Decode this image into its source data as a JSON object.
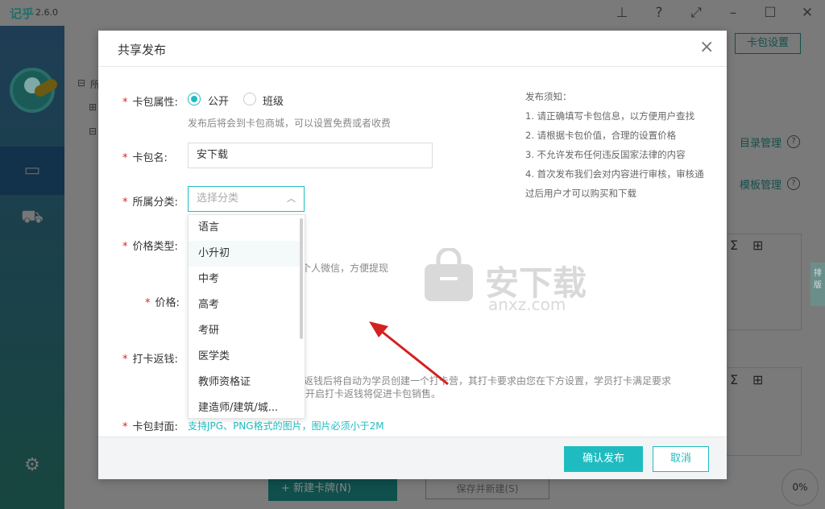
{
  "app": {
    "title": "记乎",
    "version": "2.6.0"
  },
  "background": {
    "card_settings_button": "卡包设置",
    "catalog_manage": "目录管理",
    "template_manage": "模板管理",
    "side_tab": "排版",
    "progress_percent": "0%",
    "new_card_button": "+ 新建卡牌(N)",
    "save_new_button": "保存并新建(S)",
    "tree_fragment": "所"
  },
  "dialog": {
    "title": "共享发布",
    "fields": {
      "visibility": {
        "label": "卡包属性:",
        "options": [
          "公开",
          "班级"
        ],
        "selected": "公开",
        "hint": "发布后将会到卡包商城，可以设置免费或者收费"
      },
      "name": {
        "label": "卡包名:",
        "value": "安下载"
      },
      "category": {
        "label": "所属分类:",
        "placeholder": "选择分类",
        "options": [
          "语言",
          "小升初",
          "中考",
          "高考",
          "考研",
          "医学类",
          "教师资格证",
          "建造师/建筑/城..."
        ],
        "hovered": "小升初"
      },
      "price_type": {
        "label": "价格类型:",
        "hint_partial": "个人微信，方便提现"
      },
      "price": {
        "label": "价格:"
      },
      "checkin_refund": {
        "label": "打卡返钱:",
        "hint_line1": "返钱后将自动为学员创建一个打卡营，其打卡要求由您在下方设置，学员打卡满足要求",
        "hint_line2": "开启打卡返钱将促进卡包销售。"
      },
      "cover": {
        "label": "卡包封面:",
        "hint": "支持JPG、PNG格式的图片，图片必须小于2M"
      }
    },
    "notice": {
      "title": "发布须知：",
      "items": [
        "1. 请正确填写卡包信息，以方便用户查找",
        "2. 请根据卡包价值，合理的设置价格",
        "3. 不允许发布任何违反国家法律的内容",
        "4. 首次发布我们会对内容进行审核，审核通过后用户才可以购买和下载"
      ]
    },
    "buttons": {
      "confirm": "确认发布",
      "cancel": "取消"
    }
  },
  "watermark": {
    "text": "安下载",
    "sub": "anxz.com"
  },
  "colors": {
    "accent": "#1ebcc0",
    "required": "#e02020",
    "arrow": "#d42020"
  }
}
